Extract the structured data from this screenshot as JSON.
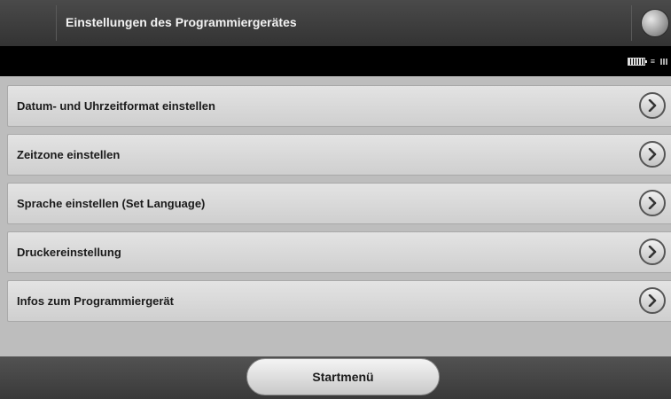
{
  "header": {
    "title": "Einstellungen des Programmiergerätes",
    "globe_icon": "globe-icon"
  },
  "status": {
    "icons": [
      "battery-icon",
      "wifi-icon",
      "signal-icon"
    ]
  },
  "menu": {
    "items": [
      {
        "label": "Datum- und Uhrzeitformat einstellen",
        "icon": "chevron-right-icon"
      },
      {
        "label": "Zeitzone einstellen",
        "icon": "chevron-right-icon"
      },
      {
        "label": "Sprache einstellen (Set Language)",
        "icon": "chevron-right-icon"
      },
      {
        "label": "Druckereinstellung",
        "icon": "chevron-right-icon"
      },
      {
        "label": "Infos zum Programmiergerät",
        "icon": "chevron-right-icon"
      }
    ]
  },
  "footer": {
    "home_label": "Startmenü"
  }
}
